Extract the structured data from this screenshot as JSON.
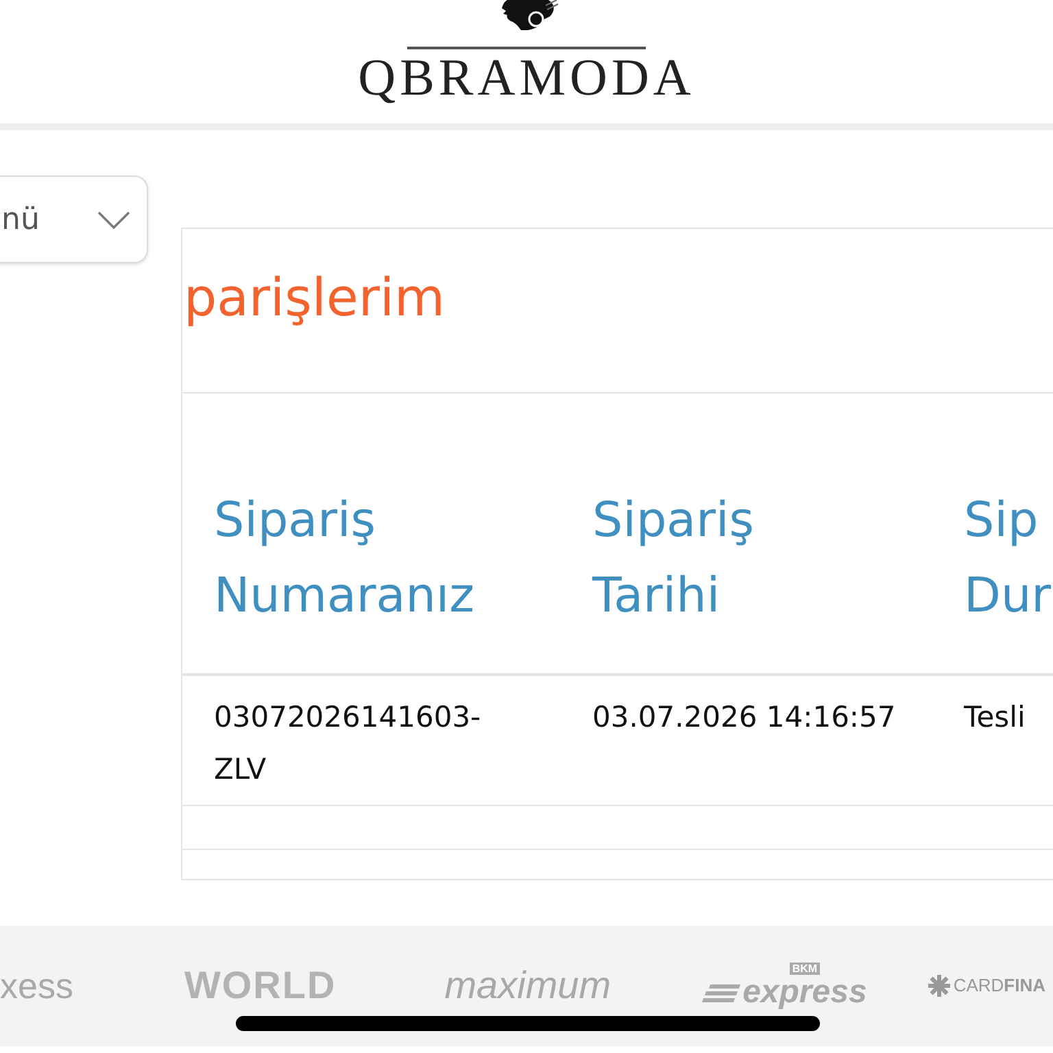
{
  "header": {
    "brand": "QBRAMODA"
  },
  "menu_dropdown": {
    "label": "nü"
  },
  "orders_panel": {
    "title": "parişlerim",
    "table": {
      "columns": [
        "Sipariş Numaranız",
        "Sipariş Tarihi",
        "Sip Dur"
      ],
      "rows": [
        [
          "03072026141603-ZLV",
          "03.07.2026 14:16:57",
          "Tesli"
        ]
      ]
    }
  },
  "payment_logos": [
    {
      "kind": "plain",
      "text": "xess"
    },
    {
      "kind": "heavy",
      "text": "WORLD"
    },
    {
      "kind": "italic",
      "text": "maximum"
    },
    {
      "kind": "badged",
      "badge": "BKM",
      "text": "express"
    },
    {
      "kind": "iconed",
      "text": "CARD**FINA**"
    }
  ]
}
